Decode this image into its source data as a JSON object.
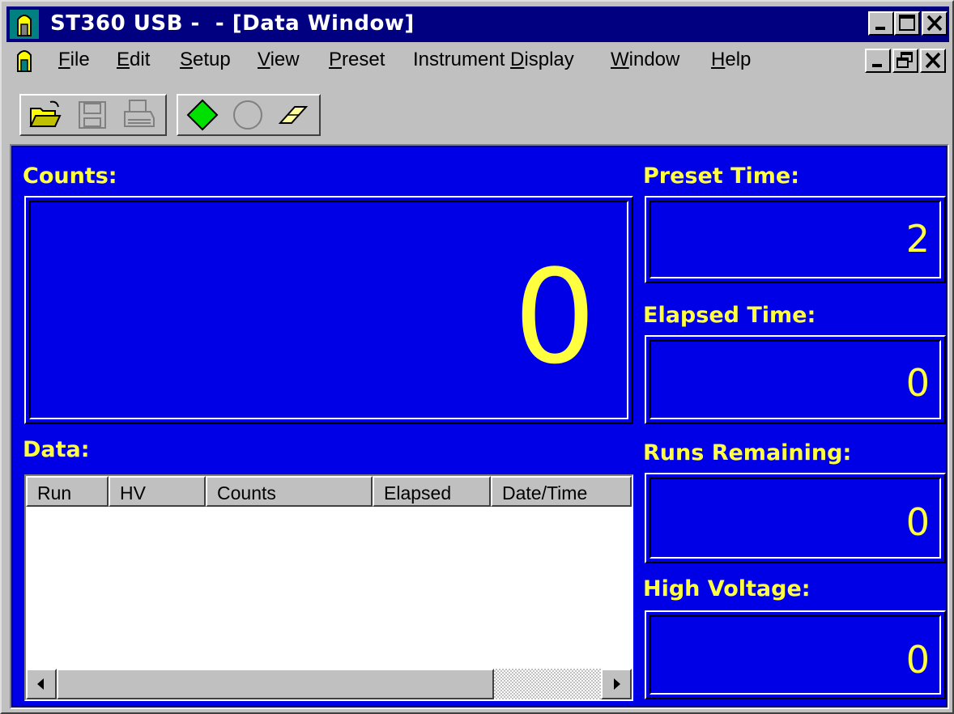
{
  "window": {
    "title": "ST360 USB -  - [Data Window]"
  },
  "menu": {
    "items": [
      {
        "mnemonic": "F",
        "rest": "ile"
      },
      {
        "mnemonic": "E",
        "rest": "dit"
      },
      {
        "mnemonic": "S",
        "rest": "etup"
      },
      {
        "mnemonic": "V",
        "rest": "iew"
      },
      {
        "mnemonic": "P",
        "rest": "reset"
      },
      {
        "pre": "Instrument ",
        "mnemonic": "D",
        "rest": "isplay"
      },
      {
        "mnemonic": "W",
        "rest": "indow"
      },
      {
        "mnemonic": "H",
        "rest": "elp"
      }
    ]
  },
  "toolbar": {
    "icons": [
      "open-folder-icon",
      "save-disk-icon",
      "print-icon",
      "start-diamond-icon",
      "stop-circle-icon",
      "eraser-icon"
    ]
  },
  "counts": {
    "label": "Counts:",
    "value": "0"
  },
  "preset_time": {
    "label": "Preset Time:",
    "value": "2"
  },
  "elapsed_time": {
    "label": "Elapsed Time:",
    "value": "0"
  },
  "runs_remaining": {
    "label": "Runs Remaining:",
    "value": "0"
  },
  "high_voltage": {
    "label": "High Voltage:",
    "value": "0"
  },
  "data": {
    "label": "Data:",
    "columns": [
      "Run",
      "HV",
      "Counts",
      "Elapsed",
      "Date/Time"
    ],
    "rows": []
  },
  "colors": {
    "panel": "#0000e6",
    "title_bar": "#000080",
    "value_text": "#ffff40"
  }
}
